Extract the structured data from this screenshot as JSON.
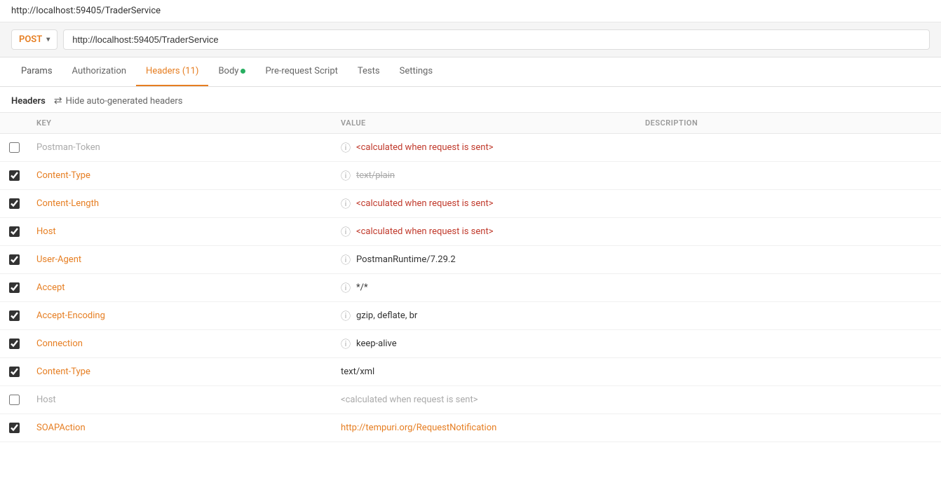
{
  "topbar": {
    "url": "http://localhost:59405/TraderService"
  },
  "urlbar": {
    "method": "POST",
    "url": "http://localhost:59405/TraderService",
    "chevron": "▾"
  },
  "tabs": [
    {
      "id": "params",
      "label": "Params",
      "active": false,
      "badge": "",
      "dot": false
    },
    {
      "id": "authorization",
      "label": "Authorization",
      "active": false,
      "badge": "",
      "dot": false
    },
    {
      "id": "headers",
      "label": "Headers (11)",
      "active": true,
      "badge": "(11)",
      "dot": false
    },
    {
      "id": "body",
      "label": "Body",
      "active": false,
      "badge": "",
      "dot": true
    },
    {
      "id": "pre-request-script",
      "label": "Pre-request Script",
      "active": false,
      "badge": "",
      "dot": false
    },
    {
      "id": "tests",
      "label": "Tests",
      "active": false,
      "badge": "",
      "dot": false
    },
    {
      "id": "settings",
      "label": "Settings",
      "active": false,
      "badge": "",
      "dot": false
    }
  ],
  "headers_section": {
    "label": "Headers",
    "hide_button": "Hide auto-generated headers"
  },
  "table": {
    "columns": {
      "key": "KEY",
      "value": "VALUE",
      "description": "DESCRIPTION"
    },
    "rows": [
      {
        "id": 1,
        "checked": false,
        "key": "Postman-Token",
        "key_color": "gray",
        "has_info": true,
        "value": "<calculated when request is sent>",
        "value_color": "red",
        "value_strikethrough": false,
        "description": ""
      },
      {
        "id": 2,
        "checked": true,
        "key": "Content-Type",
        "key_color": "orange",
        "has_info": true,
        "value": "text/plain",
        "value_color": "strikethrough",
        "value_strikethrough": true,
        "description": ""
      },
      {
        "id": 3,
        "checked": true,
        "key": "Content-Length",
        "key_color": "orange",
        "has_info": true,
        "value": "<calculated when request is sent>",
        "value_color": "red",
        "value_strikethrough": false,
        "description": ""
      },
      {
        "id": 4,
        "checked": true,
        "key": "Host",
        "key_color": "orange",
        "has_info": true,
        "value": "<calculated when request is sent>",
        "value_color": "red",
        "value_strikethrough": false,
        "description": ""
      },
      {
        "id": 5,
        "checked": true,
        "key": "User-Agent",
        "key_color": "orange",
        "has_info": true,
        "value": "PostmanRuntime/7.29.2",
        "value_color": "black",
        "value_strikethrough": false,
        "description": ""
      },
      {
        "id": 6,
        "checked": true,
        "key": "Accept",
        "key_color": "orange",
        "has_info": true,
        "value": "*/*",
        "value_color": "black",
        "value_strikethrough": false,
        "description": ""
      },
      {
        "id": 7,
        "checked": true,
        "key": "Accept-Encoding",
        "key_color": "orange",
        "has_info": true,
        "value": "gzip, deflate, br",
        "value_color": "black",
        "value_strikethrough": false,
        "description": ""
      },
      {
        "id": 8,
        "checked": true,
        "key": "Connection",
        "key_color": "orange",
        "has_info": true,
        "value": "keep-alive",
        "value_color": "black",
        "value_strikethrough": false,
        "description": ""
      },
      {
        "id": 9,
        "checked": true,
        "key": "Content-Type",
        "key_color": "orange",
        "has_info": false,
        "value": "text/xml",
        "value_color": "black",
        "value_strikethrough": false,
        "description": ""
      },
      {
        "id": 10,
        "checked": false,
        "key": "Host",
        "key_color": "gray",
        "has_info": false,
        "value": "<calculated when request is sent>",
        "value_color": "gray_placeholder",
        "value_strikethrough": false,
        "description": ""
      },
      {
        "id": 11,
        "checked": true,
        "key": "SOAPAction",
        "key_color": "orange",
        "has_info": false,
        "value": "http://tempuri.org/RequestNotification",
        "value_color": "link",
        "value_strikethrough": false,
        "description": ""
      }
    ]
  },
  "icons": {
    "info": "ⓘ",
    "hide": "⇄"
  }
}
